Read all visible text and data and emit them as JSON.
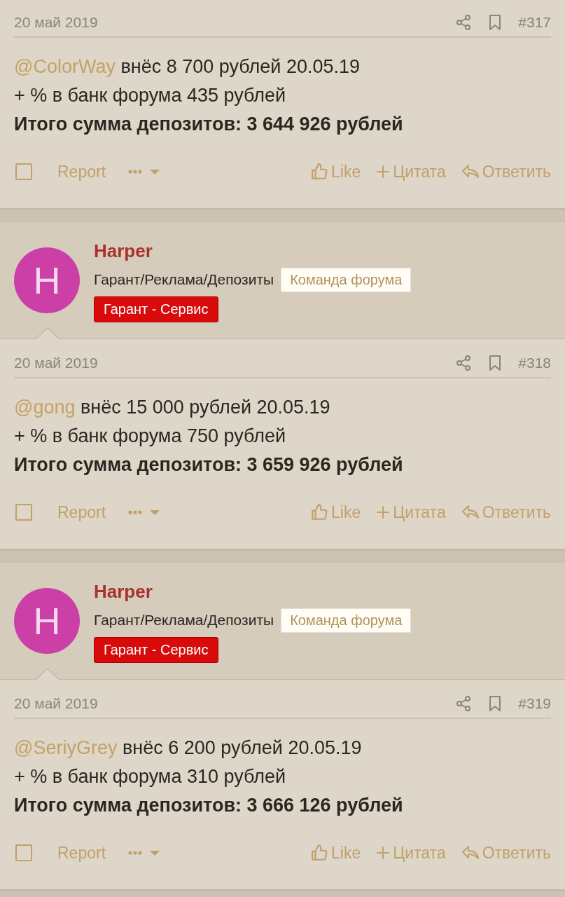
{
  "posts": [
    {
      "date": "20 май 2019",
      "number": "#317",
      "mention": "@ColorWay",
      "first_line": "внёс 8 700 рублей 20.05.19",
      "second_line": "+ % в банк форума 435 рублей",
      "total": "Итого сумма депозитов: 3 644 926 рублей",
      "checked": false,
      "actions": {
        "report": "Report",
        "like": "Like",
        "quote": "Цитата",
        "reply": "Ответить"
      }
    },
    {
      "author": {
        "initial": "H",
        "name": "Harper",
        "title": "Гарант/Реклама/Депозиты",
        "team_badge": "Команда форума",
        "banner": "Гарант - Сервис",
        "color": "#cc3fa6"
      },
      "date": "20 май 2019",
      "number": "#318",
      "mention": "@gong",
      "first_line": "внёс 15 000 рублей 20.05.19",
      "second_line": "+ % в банк форума 750 рублей",
      "total": "Итого сумма депозитов: 3 659 926 рублей",
      "checked": false,
      "actions": {
        "report": "Report",
        "like": "Like",
        "quote": "Цитата",
        "reply": "Ответить"
      }
    },
    {
      "author": {
        "initial": "H",
        "name": "Harper",
        "title": "Гарант/Реклама/Депозиты",
        "team_badge": "Команда форума",
        "banner": "Гарант - Сервис",
        "color": "#cc3fa6"
      },
      "date": "20 май 2019",
      "number": "#319",
      "mention": "@SeriyGrey",
      "first_line": "внёс 6 200 рублей 20.05.19",
      "second_line": "+ % в банк форума 310 рублей",
      "total": "Итого сумма депозитов: 3 666 126 рублей",
      "checked": false,
      "actions": {
        "report": "Report",
        "like": "Like",
        "quote": "Цитата",
        "reply": "Ответить"
      }
    }
  ]
}
